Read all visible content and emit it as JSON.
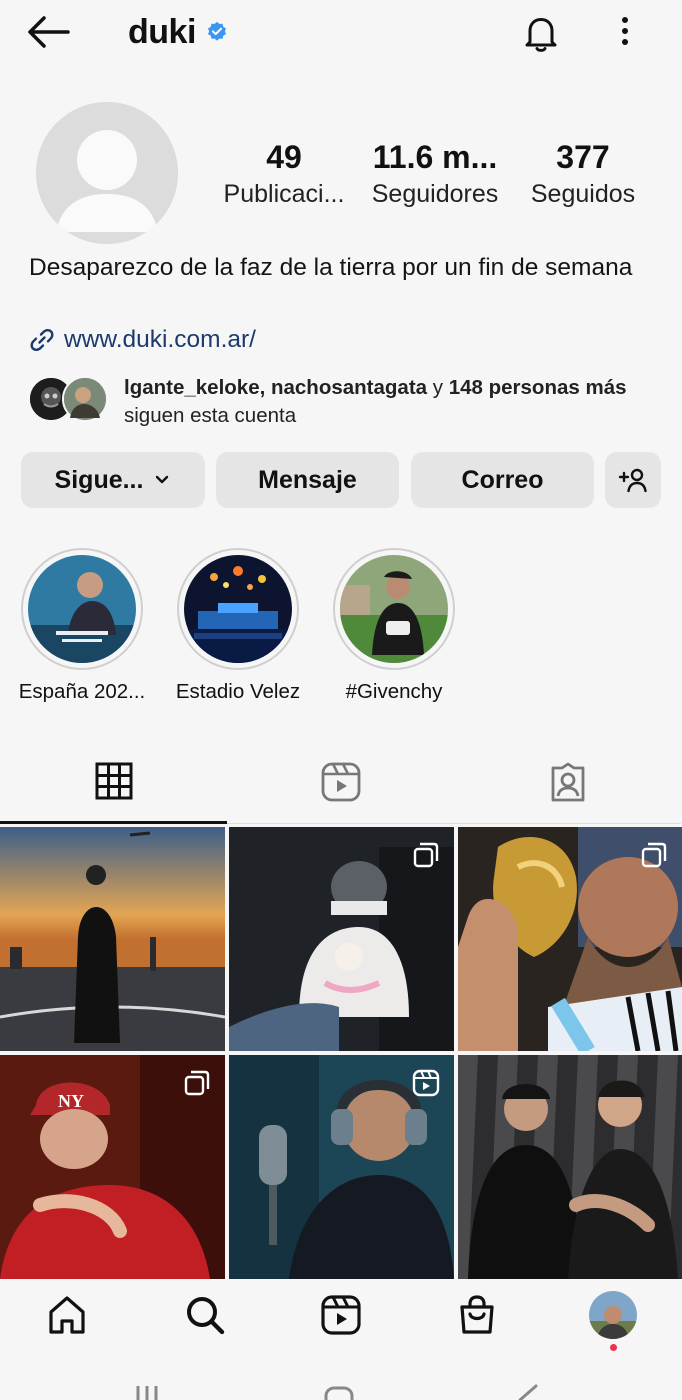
{
  "header": {
    "username": "duki",
    "verified": true,
    "icons": [
      "back-arrow-icon",
      "verified-badge-icon",
      "bell-icon",
      "more-vertical-icon"
    ]
  },
  "profile": {
    "stats": {
      "posts_value": "49",
      "posts_label": "Publicaci...",
      "followers_value": "11.6 m...",
      "followers_label": "Seguidores",
      "following_value": "377",
      "following_label": "Seguidos"
    },
    "bio": "Desaparezco de la faz de la tierra por un fin de semana",
    "link": "www.duki.com.ar/",
    "mutual": {
      "names": "lgante_keloke, nachosantagata",
      "joiner": " y ",
      "count": "148 personas más",
      "suffix": " siguen esta cuenta"
    }
  },
  "actions": {
    "following_label": "Sigue...",
    "message_label": "Mensaje",
    "email_label": "Correo"
  },
  "highlights": [
    {
      "label": "España 202..."
    },
    {
      "label": "Estadio Velez"
    },
    {
      "label": "#Givenchy"
    }
  ],
  "colors": {
    "background": "#f6f6f6",
    "verified_blue": "#3897f0",
    "link": "#1c3a6b",
    "button_bg": "#e5e5e5",
    "notification_dot": "#e8334a"
  }
}
